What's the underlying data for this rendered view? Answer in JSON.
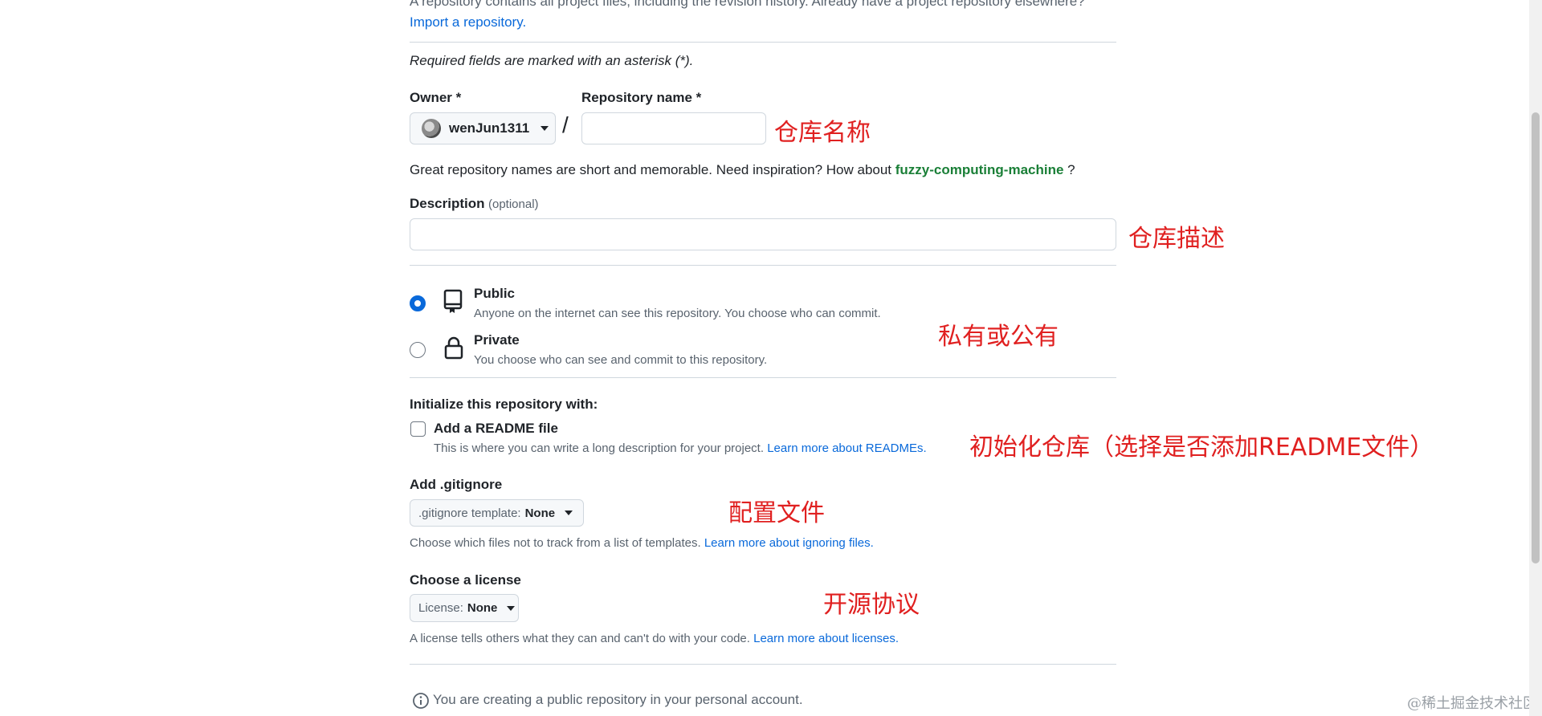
{
  "intro": {
    "text": "A repository contains all project files, including the revision history. Already have a project repository elsewhere?",
    "import_link": "Import a repository."
  },
  "required_note": "Required fields are marked with an asterisk (*).",
  "owner": {
    "label": "Owner *",
    "value": "wenJun1311"
  },
  "slash": "/",
  "repo_name": {
    "label": "Repository name *",
    "value": "",
    "placeholder": ""
  },
  "suggestion": {
    "prefix": "Great repository names are short and memorable. Need inspiration? How about",
    "name": "fuzzy-computing-machine",
    "suffix": "?"
  },
  "description": {
    "label": "Description",
    "optional": "(optional)",
    "value": ""
  },
  "visibility": {
    "public": {
      "title": "Public",
      "desc": "Anyone on the internet can see this repository. You choose who can commit.",
      "icon": "repo-icon",
      "checked": true
    },
    "private": {
      "title": "Private",
      "desc": "You choose who can see and commit to this repository.",
      "icon": "lock-icon",
      "checked": false
    }
  },
  "init": {
    "heading": "Initialize this repository with:",
    "readme_label": "Add a README file",
    "readme_desc": "This is where you can write a long description for your project.",
    "readme_link": "Learn more about READMEs."
  },
  "gitignore": {
    "heading": "Add .gitignore",
    "select_prefix": ".gitignore template:",
    "select_value": "None",
    "desc": "Choose which files not to track from a list of templates.",
    "link": "Learn more about ignoring files."
  },
  "license": {
    "heading": "Choose a license",
    "select_prefix": "License:",
    "select_value": "None",
    "desc": "A license tells others what they can and can't do with your code.",
    "link": "Learn more about licenses."
  },
  "notice": {
    "icon": "info-icon",
    "text": "You are creating a public repository in your personal account."
  },
  "annotations": {
    "repo_name": "仓库名称",
    "description": "仓库描述",
    "visibility": "私有或公有",
    "init": "初始化仓库（选择是否添加README文件）",
    "gitignore": "配置文件",
    "license": "开源协议"
  },
  "watermark": "@稀土掘金技术社区",
  "colors": {
    "link": "#0969da",
    "suggestion": "#1a7f37",
    "annotation": "#e02020",
    "radio_checked": "#0969da"
  }
}
